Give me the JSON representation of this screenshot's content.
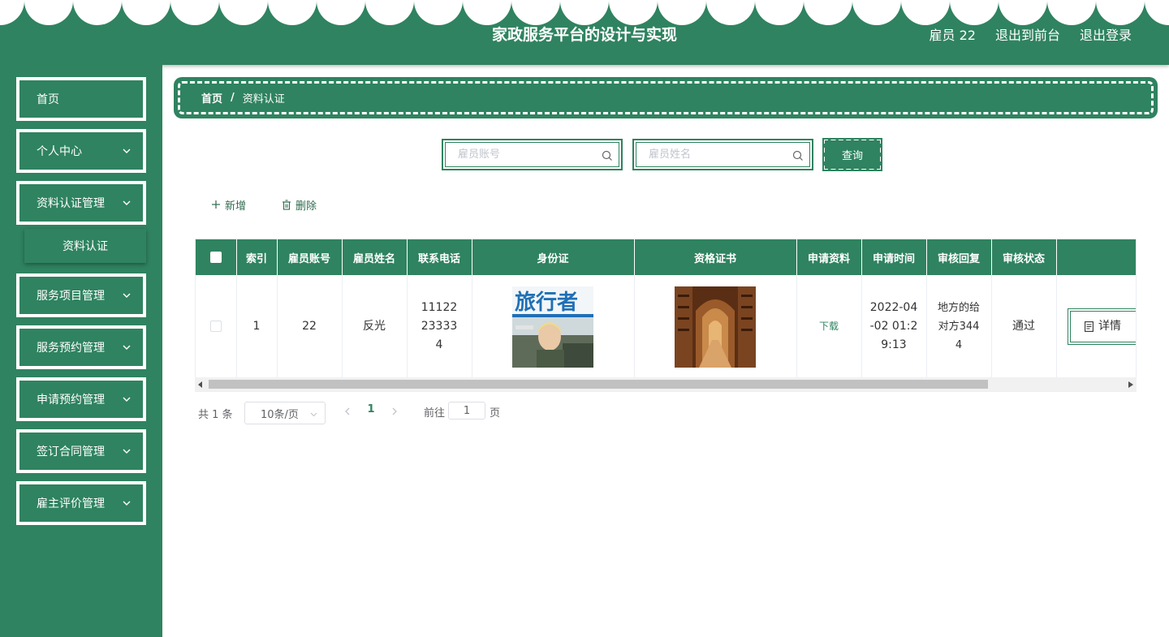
{
  "header": {
    "title": "家政服务平台的设计与实现",
    "user": "雇员 22",
    "to_front": "退出到前台",
    "logout": "退出登录"
  },
  "sidebar": {
    "items": [
      {
        "label": "首页"
      },
      {
        "label": "个人中心"
      },
      {
        "label": "资料认证管理"
      },
      {
        "label": "服务项目管理"
      },
      {
        "label": "服务预约管理"
      },
      {
        "label": "申请预约管理"
      },
      {
        "label": "签订合同管理"
      },
      {
        "label": "雇主评价管理"
      }
    ],
    "subitem": "资料认证"
  },
  "breadcrumb": {
    "home": "首页",
    "separator": "/",
    "current": "资料认证"
  },
  "search": {
    "account_placeholder": "雇员账号",
    "name_placeholder": "雇员姓名",
    "query_label": "查询"
  },
  "actions": {
    "add": "新增",
    "delete": "删除"
  },
  "table": {
    "headers": [
      "索引",
      "雇员账号",
      "雇员姓名",
      "联系电话",
      "身份证",
      "资格证书",
      "申请资料",
      "申请时间",
      "审核回复",
      "审核状态"
    ],
    "rows": [
      {
        "index": "1",
        "account": "22",
        "name": "反光",
        "phone": "11122233334",
        "id_card_image": "magazine-cover",
        "id_card_text": "旅行者",
        "certificate_image": "library-photo",
        "material": "下载",
        "time": "2022-04-02 01:29:13",
        "reply": "地方的给对方3444",
        "status": "通过",
        "detail": "详情"
      }
    ]
  },
  "pagination": {
    "total": "共 1 条",
    "page_size": "10条/页",
    "current_page": "1",
    "goto_label": "前往",
    "goto_value": "1",
    "goto_suffix": "页"
  },
  "colors": {
    "primary": "#2f8360",
    "white": "#ffffff"
  }
}
